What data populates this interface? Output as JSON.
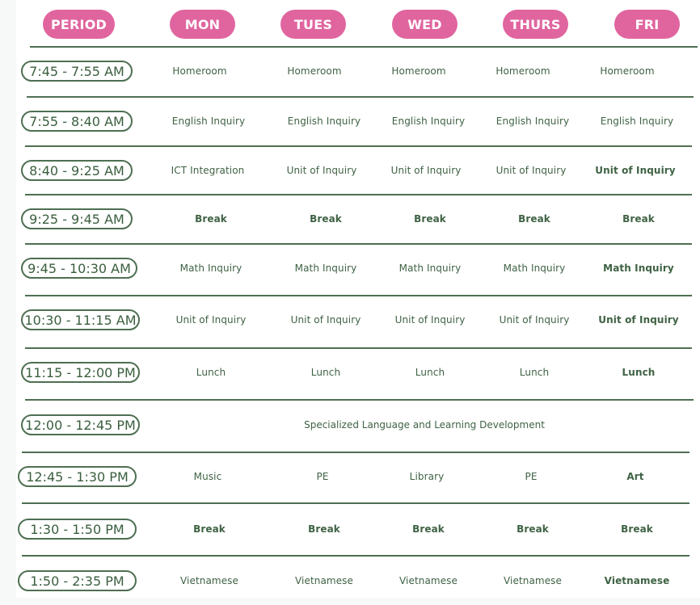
{
  "header": {
    "period": "PERIOD",
    "days": [
      "MON",
      "TUES",
      "WED",
      "THURS",
      "FRI"
    ]
  },
  "rows": [
    {
      "time": "7:45 - 7:55 AM",
      "cells": [
        "Homeroom",
        "Homeroom",
        "Homeroom",
        "Homeroom",
        "Homeroom"
      ]
    },
    {
      "time": "7:55 - 8:40 AM",
      "cells": [
        "English Inquiry",
        "English Inquiry",
        "English Inquiry",
        "English Inquiry",
        "English Inquiry"
      ]
    },
    {
      "time": "8:40 - 9:25 AM",
      "cells": [
        "ICT Integration",
        "Unit of Inquiry",
        "Unit of Inquiry",
        "Unit of Inquiry",
        "Unit of Inquiry"
      ]
    },
    {
      "time": "9:25 - 9:45 AM",
      "cells": [
        "Break",
        "Break",
        "Break",
        "Break",
        "Break"
      ]
    },
    {
      "time": "9:45 - 10:30 AM",
      "cells": [
        "Math Inquiry",
        "Math Inquiry",
        "Math Inquiry",
        "Math Inquiry",
        "Math Inquiry"
      ]
    },
    {
      "time": "10:30 - 11:15 AM",
      "cells": [
        "Unit of Inquiry",
        "Unit of Inquiry",
        "Unit of Inquiry",
        "Unit of Inquiry",
        "Unit of Inquiry"
      ]
    },
    {
      "time": "11:15 - 12:00 PM",
      "cells": [
        "Lunch",
        "Lunch",
        "Lunch",
        "Lunch",
        "Lunch"
      ]
    },
    {
      "time": "12:00 - 12:45 PM",
      "span": "Specialized Language and Learning Development"
    },
    {
      "time": "12:45 - 1:30 PM",
      "cells": [
        "Music",
        "PE",
        "Library",
        "PE",
        "Art"
      ]
    },
    {
      "time": "1:30 - 1:50 PM",
      "cells": [
        "Break",
        "Break",
        "Break",
        "Break",
        "Break"
      ]
    },
    {
      "time": "1:50 - 2:35 PM",
      "cells": [
        "Vietnamese",
        "Vietnamese",
        "Vietnamese",
        "Vietnamese",
        "Vietnamese"
      ]
    }
  ],
  "colors": {
    "header_pill": "#e0659f",
    "accent_green": "#4e6f52",
    "text_green": "#3f6244"
  }
}
